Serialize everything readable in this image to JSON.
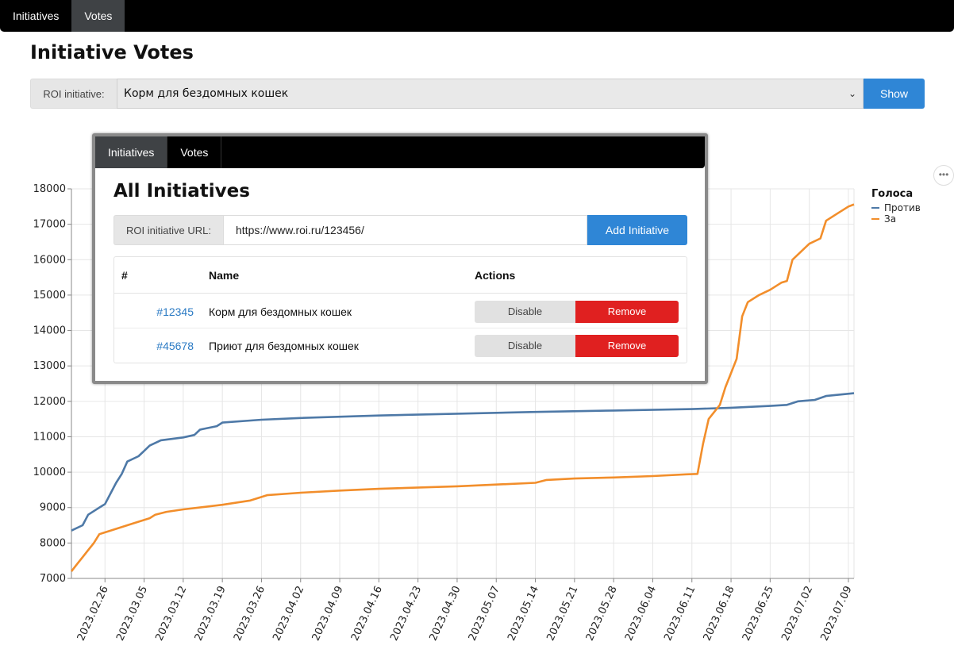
{
  "nav": {
    "tabs": [
      {
        "label": "Initiatives"
      },
      {
        "label": "Votes"
      }
    ]
  },
  "page": {
    "title": "Initiative Votes"
  },
  "selector": {
    "label": "ROI initiative:",
    "selected": "Корм для бездомных кошек",
    "button": "Show"
  },
  "popup": {
    "tabs": [
      {
        "label": "Initiatives"
      },
      {
        "label": "Votes"
      }
    ],
    "title": "All Initiatives",
    "url_label": "ROI initiative URL:",
    "url_value": "https://www.roi.ru/123456/",
    "add_button": "Add Initiative",
    "table": {
      "headers": {
        "num": "#",
        "name": "Name",
        "actions": "Actions"
      },
      "rows": [
        {
          "id": "#12345",
          "name": "Корм для бездомных кошек",
          "disable": "Disable",
          "remove": "Remove"
        },
        {
          "id": "#45678",
          "name": "Приют для бездомных кошек",
          "disable": "Disable",
          "remove": "Remove"
        }
      ]
    }
  },
  "more_icon": "ellipsis-icon",
  "chart_data": {
    "type": "line",
    "legend_title": "Голоса",
    "legend_position": "top-right",
    "ylim": [
      7000,
      18000
    ],
    "y_ticks": [
      7000,
      8000,
      9000,
      10000,
      11000,
      12000,
      13000,
      14000,
      15000,
      16000,
      17000,
      18000
    ],
    "x_range": [
      "2023-02-20",
      "2023-07-10"
    ],
    "x_ticks": [
      "2023.02.26",
      "2023.03.05",
      "2023.03.12",
      "2023.03.19",
      "2023.03.26",
      "2023.04.02",
      "2023.04.09",
      "2023.04.16",
      "2023.04.23",
      "2023.04.30",
      "2023.05.07",
      "2023.05.14",
      "2023.05.21",
      "2023.05.28",
      "2023.06.04",
      "2023.06.11",
      "2023.06.18",
      "2023.06.25",
      "2023.07.02",
      "2023.07.09"
    ],
    "grid": true,
    "series": [
      {
        "name": "Против",
        "color": "#4e79a7",
        "points": [
          [
            "2023-02-20",
            8350
          ],
          [
            "2023-02-22",
            8500
          ],
          [
            "2023-02-23",
            8800
          ],
          [
            "2023-02-25",
            9000
          ],
          [
            "2023-02-26",
            9100
          ],
          [
            "2023-02-27",
            9400
          ],
          [
            "2023-02-28",
            9700
          ],
          [
            "2023-03-01",
            9950
          ],
          [
            "2023-03-02",
            10300
          ],
          [
            "2023-03-04",
            10450
          ],
          [
            "2023-03-05",
            10600
          ],
          [
            "2023-03-06",
            10750
          ],
          [
            "2023-03-08",
            10900
          ],
          [
            "2023-03-12",
            10980
          ],
          [
            "2023-03-14",
            11050
          ],
          [
            "2023-03-15",
            11200
          ],
          [
            "2023-03-18",
            11300
          ],
          [
            "2023-03-19",
            11400
          ],
          [
            "2023-03-26",
            11480
          ],
          [
            "2023-04-02",
            11530
          ],
          [
            "2023-04-16",
            11600
          ],
          [
            "2023-04-30",
            11650
          ],
          [
            "2023-05-14",
            11700
          ],
          [
            "2023-05-28",
            11740
          ],
          [
            "2023-06-11",
            11780
          ],
          [
            "2023-06-18",
            11820
          ],
          [
            "2023-06-25",
            11870
          ],
          [
            "2023-06-28",
            11900
          ],
          [
            "2023-06-30",
            12000
          ],
          [
            "2023-07-03",
            12040
          ],
          [
            "2023-07-05",
            12150
          ],
          [
            "2023-07-10",
            12230
          ]
        ]
      },
      {
        "name": "За",
        "color": "#f28e2b",
        "points": [
          [
            "2023-02-20",
            7200
          ],
          [
            "2023-02-21",
            7400
          ],
          [
            "2023-02-22",
            7600
          ],
          [
            "2023-02-23",
            7800
          ],
          [
            "2023-02-24",
            8000
          ],
          [
            "2023-02-25",
            8250
          ],
          [
            "2023-02-27",
            8350
          ],
          [
            "2023-03-01",
            8450
          ],
          [
            "2023-03-03",
            8550
          ],
          [
            "2023-03-06",
            8700
          ],
          [
            "2023-03-07",
            8800
          ],
          [
            "2023-03-09",
            8880
          ],
          [
            "2023-03-12",
            8950
          ],
          [
            "2023-03-19",
            9080
          ],
          [
            "2023-03-24",
            9200
          ],
          [
            "2023-03-27",
            9350
          ],
          [
            "2023-04-02",
            9420
          ],
          [
            "2023-04-09",
            9480
          ],
          [
            "2023-04-16",
            9530
          ],
          [
            "2023-04-30",
            9600
          ],
          [
            "2023-05-07",
            9650
          ],
          [
            "2023-05-14",
            9700
          ],
          [
            "2023-05-16",
            9780
          ],
          [
            "2023-05-21",
            9820
          ],
          [
            "2023-05-28",
            9850
          ],
          [
            "2023-06-04",
            9890
          ],
          [
            "2023-06-10",
            9940
          ],
          [
            "2023-06-12",
            9950
          ],
          [
            "2023-06-13",
            10800
          ],
          [
            "2023-06-14",
            11500
          ],
          [
            "2023-06-16",
            11900
          ],
          [
            "2023-06-17",
            12400
          ],
          [
            "2023-06-18",
            12800
          ],
          [
            "2023-06-19",
            13200
          ],
          [
            "2023-06-20",
            14400
          ],
          [
            "2023-06-21",
            14800
          ],
          [
            "2023-06-23",
            15000
          ],
          [
            "2023-06-25",
            15150
          ],
          [
            "2023-06-27",
            15350
          ],
          [
            "2023-06-28",
            15400
          ],
          [
            "2023-06-29",
            16000
          ],
          [
            "2023-07-01",
            16300
          ],
          [
            "2023-07-02",
            16450
          ],
          [
            "2023-07-04",
            16600
          ],
          [
            "2023-07-05",
            17100
          ],
          [
            "2023-07-07",
            17300
          ],
          [
            "2023-07-09",
            17500
          ],
          [
            "2023-07-10",
            17560
          ]
        ]
      }
    ]
  }
}
